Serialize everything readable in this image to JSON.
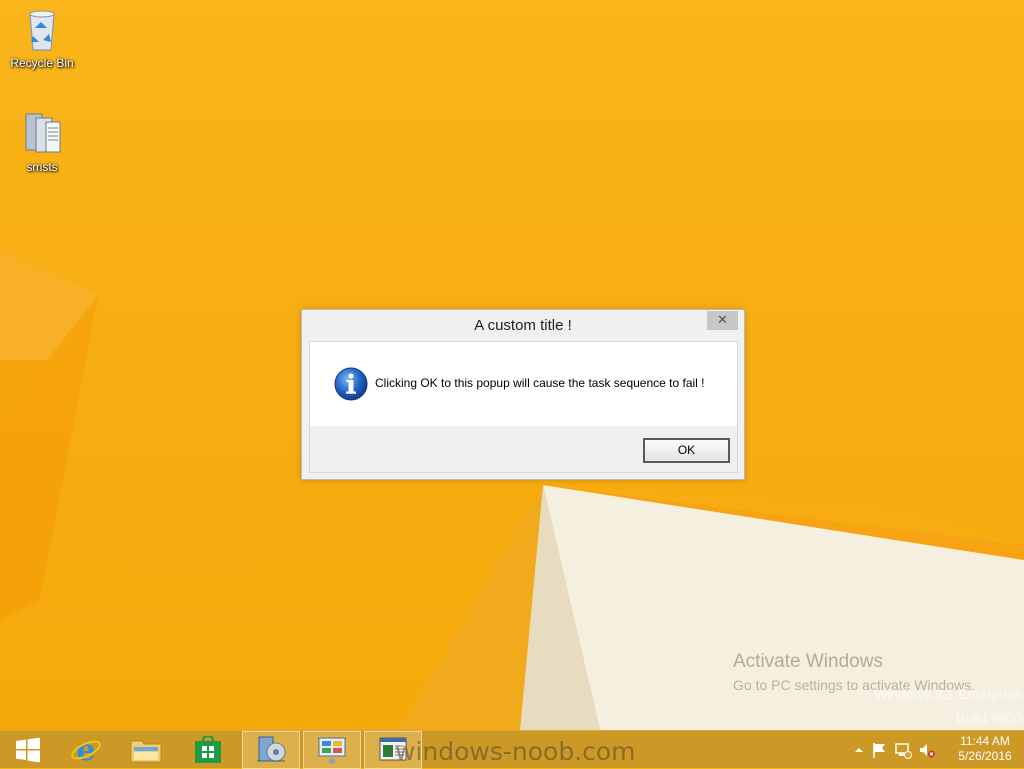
{
  "desktop": {
    "icons": [
      {
        "label": "Recycle Bin",
        "icon": "recycle-bin-icon"
      },
      {
        "label": "smsts",
        "icon": "log-file-icon"
      }
    ],
    "watermark": {
      "activate_title": "Activate Windows",
      "activate_hint": "Go to PC settings to activate Windows.",
      "edition": "Windows 8.1 Enterprise",
      "build": "Build 9600"
    }
  },
  "dialog": {
    "title": "A custom title !",
    "close_glyph": "✕",
    "message": "Clicking OK to this popup will cause the task sequence to fail !",
    "ok_label": "OK",
    "icon": "info-icon"
  },
  "taskbar": {
    "watermark_text": "windows-noob.com",
    "pinned": [
      {
        "name": "start-button",
        "icon": "windows-logo-icon"
      },
      {
        "name": "internet-explorer",
        "icon": "internet-explorer-icon"
      },
      {
        "name": "file-explorer",
        "icon": "folder-icon"
      },
      {
        "name": "store",
        "icon": "store-icon"
      },
      {
        "name": "configmgr-console",
        "icon": "config-manager-icon"
      },
      {
        "name": "control-panel",
        "icon": "control-panel-icon"
      },
      {
        "name": "cmtrace",
        "icon": "cmtrace-icon"
      }
    ],
    "clock": {
      "time": "11:44 AM",
      "date": "5/26/2016"
    },
    "tray_icons": [
      "chevron-up-icon",
      "flag-icon",
      "network-icon",
      "speaker-muted-icon"
    ]
  },
  "colors": {
    "desktop": "#f7b512",
    "taskbar": "#c89628",
    "accent_blue": "#1f5fb8"
  }
}
